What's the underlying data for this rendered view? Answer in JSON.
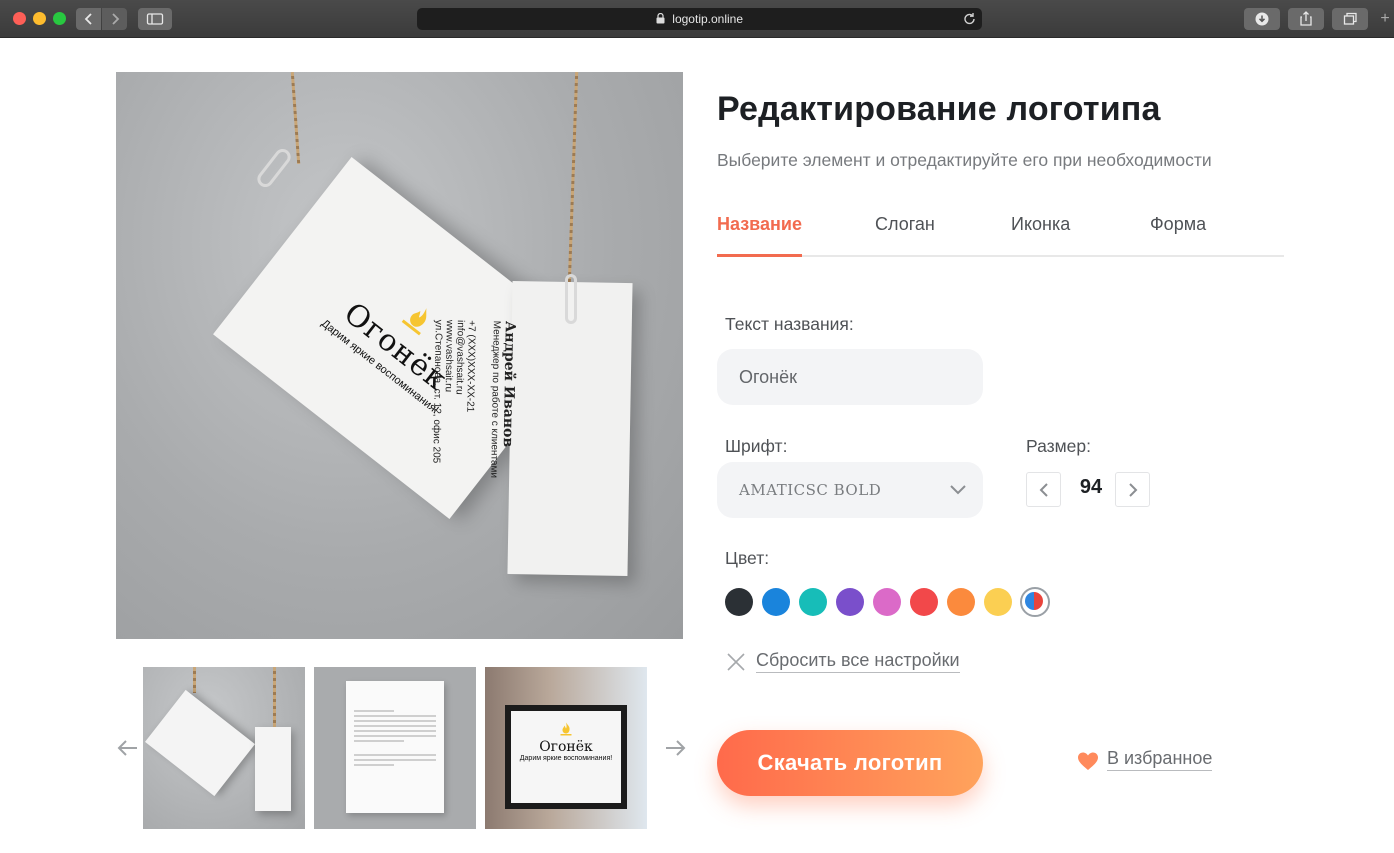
{
  "browser": {
    "url": "logotip.online",
    "icons": [
      "back-icon",
      "forward-icon",
      "sidebar-icon",
      "lock-icon",
      "reload-icon",
      "download-icon",
      "share-icon",
      "tabs-icon",
      "plus-icon"
    ]
  },
  "preview": {
    "card_brand": "Огонёк",
    "card_tagline": "Дарим яркие воспоминания!",
    "business_card": {
      "name": "Андрей Иванов",
      "position": "Менеджер по работе с клиентами",
      "phone": "+7 (XXX)XXX-XX-21",
      "email": "info@vashsait.ru",
      "site": "www.vashsait.ru",
      "address": "ул.Степанова, ст. 12, офис 205"
    }
  },
  "thumbnails": [
    {
      "name": "business-cards"
    },
    {
      "name": "letterhead"
    },
    {
      "name": "signboard",
      "brand": "Огонёк",
      "tagline": "Дарим яркие воспоминания!"
    }
  ],
  "editor": {
    "title": "Редактирование логотипа",
    "subtitle": "Выберите элемент и отредактируйте его при необходимости",
    "tabs": [
      {
        "label": "Название",
        "active": true
      },
      {
        "label": "Слоган",
        "active": false
      },
      {
        "label": "Иконка",
        "active": false
      },
      {
        "label": "Форма",
        "active": false
      }
    ],
    "name_label": "Текст названия:",
    "name_value": "Огонёк",
    "font_label": "Шрифт:",
    "font_value": "AMATICSC BOLD",
    "size_label": "Размер:",
    "size_value": "94",
    "color_label": "Цвет:",
    "colors": [
      "#2b3035",
      "#1a84dc",
      "#17bdb8",
      "#7a4fcb",
      "#db6ac8",
      "#f2484a",
      "#fb8a3d",
      "#fbcf52"
    ],
    "custom_color_selected": true,
    "reset_label": "Сбросить все настройки",
    "download_label": "Скачать логотип",
    "favorite_label": "В избранное",
    "accent_color": "#f26b4f"
  }
}
